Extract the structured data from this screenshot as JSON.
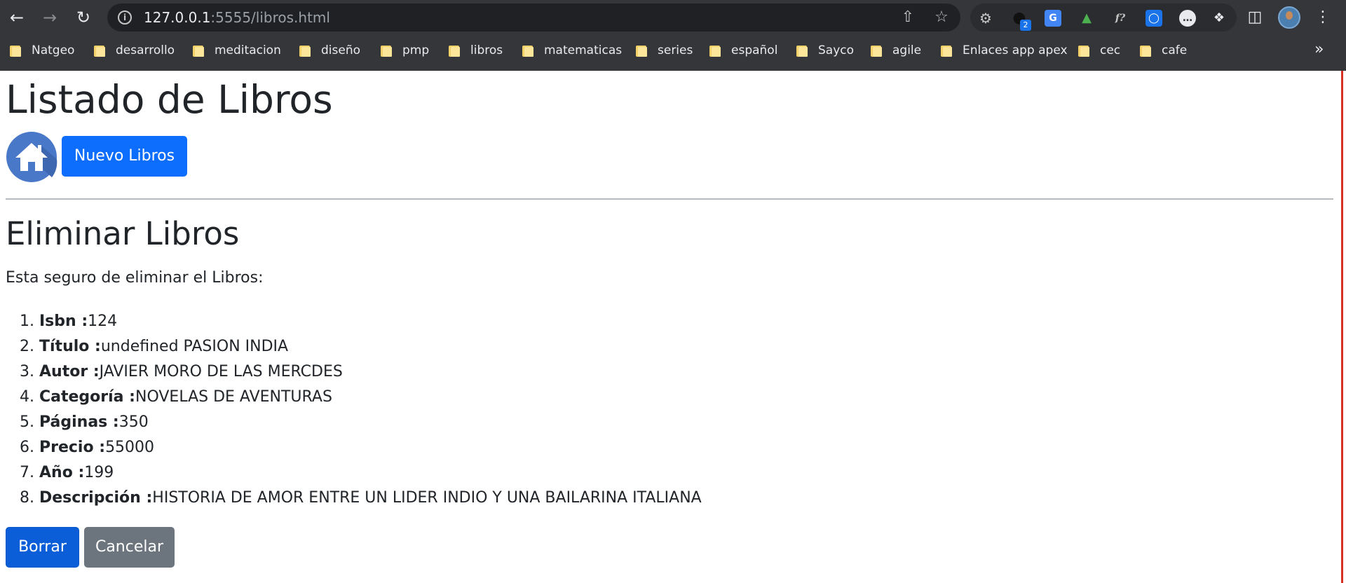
{
  "browser": {
    "url_host": "127.0.0.1",
    "url_rest": ":5555/libros.html",
    "ext_badge": "2",
    "bookmarks": [
      {
        "label": "Natgeo"
      },
      {
        "label": "desarrollo"
      },
      {
        "label": "meditacion"
      },
      {
        "label": "diseño"
      },
      {
        "label": "pmp"
      },
      {
        "label": "libros"
      },
      {
        "label": "matematicas"
      },
      {
        "label": "series"
      },
      {
        "label": "español"
      },
      {
        "label": "Sayco"
      },
      {
        "label": "agile"
      },
      {
        "label": "Enlaces app apex"
      },
      {
        "label": "cec"
      },
      {
        "label": "cafe"
      }
    ],
    "overflow_label": "»"
  },
  "page": {
    "title": "Listado de Libros",
    "new_button_label": "Nuevo Libros",
    "subtitle": "Eliminar Libros",
    "confirm_text": "Esta seguro de eliminar el Libros:",
    "details": [
      {
        "num": "1.",
        "key": "Isbn :",
        "value": "124"
      },
      {
        "num": "2.",
        "key": "Título :",
        "value": "undefined PASION INDIA"
      },
      {
        "num": "3.",
        "key": "Autor :",
        "value": "JAVIER MORO DE LAS MERCDES"
      },
      {
        "num": "4.",
        "key": "Categoría :",
        "value": "NOVELAS DE AVENTURAS"
      },
      {
        "num": "5.",
        "key": "Páginas :",
        "value": "350"
      },
      {
        "num": "6.",
        "key": "Precio :",
        "value": "55000"
      },
      {
        "num": "7.",
        "key": "Año :",
        "value": "199"
      },
      {
        "num": "8.",
        "key": "Descripción :",
        "value": "HISTORIA DE AMOR ENTRE UN LIDER INDIO Y UNA BAILARINA ITALIANA"
      }
    ],
    "delete_button_label": "Borrar",
    "cancel_button_label": "Cancelar"
  },
  "colors": {
    "primary": "#0d6efd",
    "secondary": "#6c757d",
    "chrome_bg": "#35363a",
    "home_icon_bg": "#4a78c9"
  },
  "icons": {
    "back": "back-arrow-icon",
    "forward": "forward-arrow-icon",
    "reload": "reload-icon",
    "site_info": "info-icon",
    "share": "share-icon",
    "bookmark": "star-icon",
    "extensions": "puzzle-icon",
    "side_panel": "side-panel-icon",
    "menu": "kebab-menu-icon",
    "home": "home-icon"
  }
}
